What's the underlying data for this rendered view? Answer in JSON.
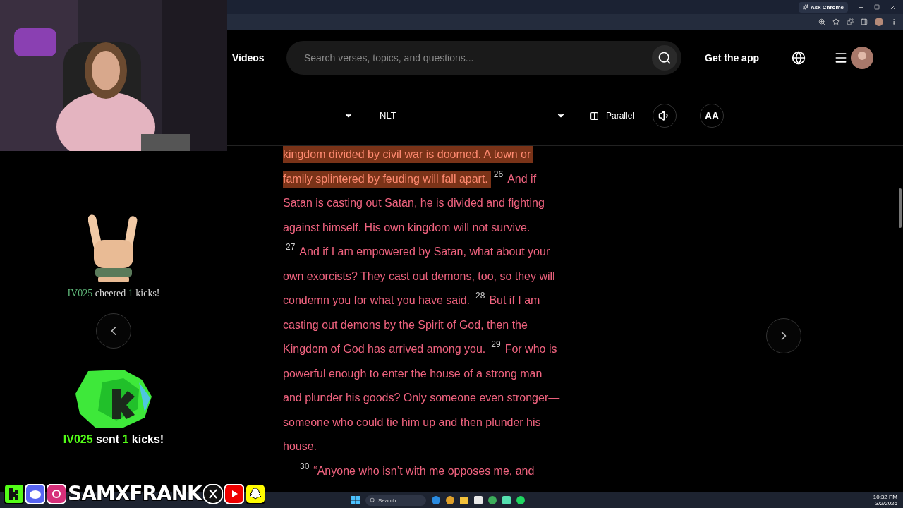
{
  "browser": {
    "ask_button": "Ask Chrome"
  },
  "header": {
    "nav_link": "Videos",
    "search": {
      "placeholder": "Search verses, topics, and questions..."
    },
    "get_app": "Get the app"
  },
  "toolbar": {
    "version": "NLT",
    "parallel": "Parallel",
    "font_button": "AA"
  },
  "passage": [
    {
      "indented": false,
      "segments": [
        {
          "text": "kingdom divided by civil war is doomed. A town or",
          "highlighted": true
        }
      ]
    },
    {
      "indented": false,
      "segments": [
        {
          "text": "family splintered by feuding will fall apart.",
          "highlighted": true
        },
        {
          "number": "26",
          "text": "And if",
          "highlighted": false
        }
      ]
    },
    {
      "indented": false,
      "segments": [
        {
          "text": "Satan is casting out Satan, he is divided and fighting",
          "highlighted": false
        }
      ]
    },
    {
      "indented": false,
      "segments": [
        {
          "text": "against himself. His own kingdom will not survive.",
          "highlighted": false
        }
      ]
    },
    {
      "indented": false,
      "segments": [
        {
          "number": "27",
          "text": "And if I am empowered by Satan, what about your",
          "highlighted": false
        }
      ]
    },
    {
      "indented": false,
      "segments": [
        {
          "text": "own exorcists? They cast out demons, too, so they will",
          "highlighted": false
        }
      ]
    },
    {
      "indented": false,
      "segments": [
        {
          "text": "condemn you for what you have said.",
          "highlighted": false
        },
        {
          "number": "28",
          "text": "But if I am",
          "highlighted": false
        }
      ]
    },
    {
      "indented": false,
      "segments": [
        {
          "text": "casting out demons by the Spirit of God, then the",
          "highlighted": false
        }
      ]
    },
    {
      "indented": false,
      "segments": [
        {
          "text": "Kingdom of God has arrived among you.",
          "highlighted": false
        },
        {
          "number": "29",
          "text": "For who is",
          "highlighted": false
        }
      ]
    },
    {
      "indented": false,
      "segments": [
        {
          "text": "powerful enough to enter the house of a strong man",
          "highlighted": false
        }
      ]
    },
    {
      "indented": false,
      "segments": [
        {
          "text": "and plunder his goods? Only someone even stronger—",
          "highlighted": false
        }
      ]
    },
    {
      "indented": false,
      "segments": [
        {
          "text": "someone who could tie him up and then plunder his",
          "highlighted": false
        }
      ]
    },
    {
      "indented": false,
      "segments": [
        {
          "text": "house.",
          "highlighted": false
        }
      ]
    },
    {
      "indented": true,
      "segments": [
        {
          "number": "30",
          "text": "“Anyone who isn’t with me opposes me, and",
          "highlighted": false
        }
      ]
    }
  ],
  "alerts": [
    {
      "kind": "cheer",
      "user": "IV025",
      "action": "cheered",
      "amount": "1",
      "unit": "kicks!"
    },
    {
      "kind": "gift",
      "user": "IV025",
      "action": "sent",
      "amount": "1",
      "unit": "kicks!"
    }
  ],
  "social_bar": {
    "handle": "SAMXFRANK"
  },
  "taskbar": {
    "search": "Search",
    "time": "10:32 PM",
    "date": "3/2/2026"
  }
}
